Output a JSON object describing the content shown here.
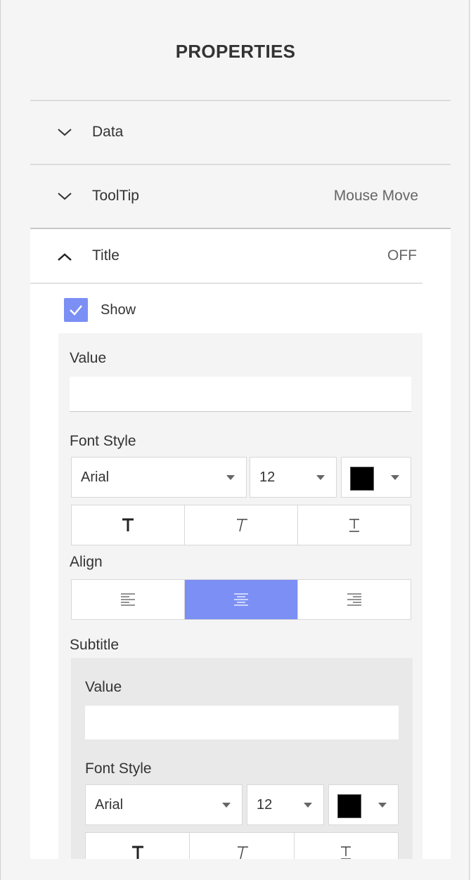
{
  "panel": {
    "title": "PROPERTIES"
  },
  "sections": {
    "data": {
      "label": "Data",
      "icon": "chevron-down-icon"
    },
    "tooltip": {
      "label": "ToolTip",
      "value": "Mouse Move",
      "icon": "chevron-down-icon"
    },
    "title": {
      "label": "Title",
      "value": "OFF",
      "icon": "chevron-up-icon"
    }
  },
  "title_settings": {
    "show": {
      "label": "Show",
      "checked": true
    },
    "value_label": "Value",
    "value": "",
    "font_style_label": "Font Style",
    "font_family": "Arial",
    "font_size": "12",
    "font_color": "#000000",
    "style_buttons": [
      "bold-icon",
      "italic-icon",
      "underline-icon"
    ],
    "align_label": "Align",
    "align_buttons": [
      "align-left-icon",
      "align-center-icon",
      "align-right-icon"
    ],
    "align_selected": "center"
  },
  "subtitle_settings": {
    "section_label": "Subtitle",
    "value_label": "Value",
    "value": "",
    "font_style_label": "Font Style",
    "font_family": "Arial",
    "font_size": "12",
    "font_color": "#000000",
    "style_buttons": [
      "bold-icon",
      "italic-icon",
      "underline-icon"
    ]
  },
  "colors": {
    "accent": "#7b8ff5",
    "panel_bg": "#f5f5f5",
    "subtitle_bg": "#e9e9e9"
  }
}
